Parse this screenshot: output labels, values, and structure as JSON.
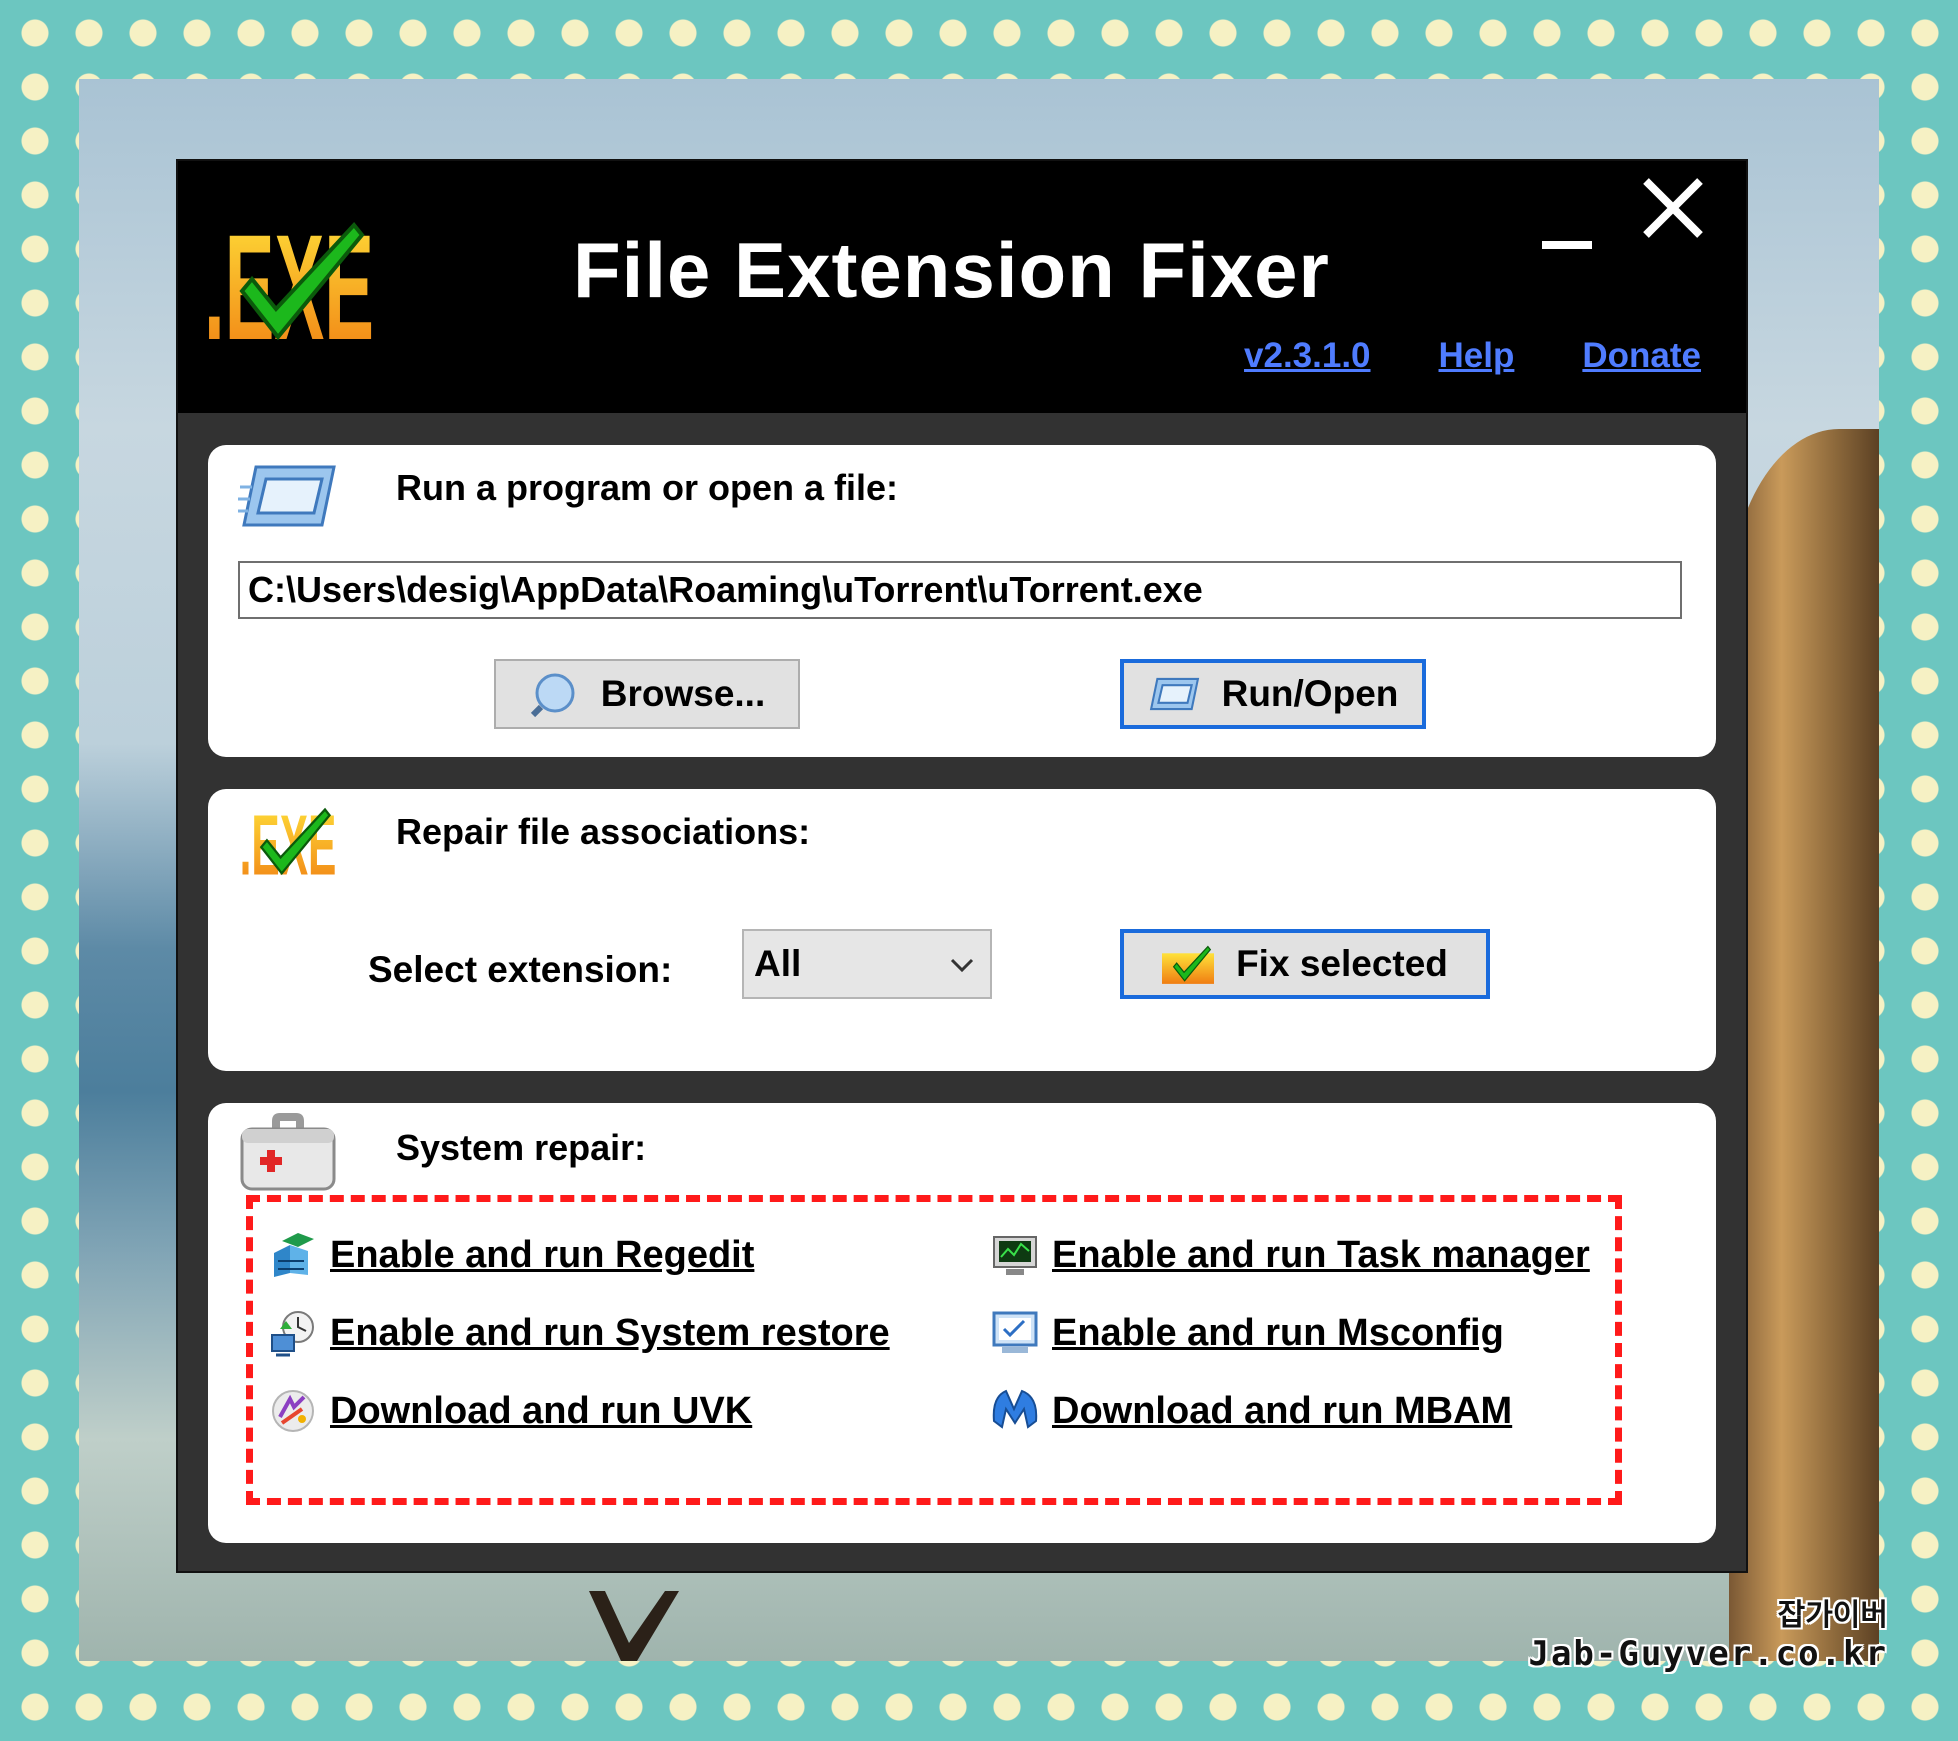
{
  "app": {
    "title": "File Extension Fixer",
    "version_link": "v2.3.1.0",
    "help_link": "Help",
    "donate_link": "Donate"
  },
  "run_section": {
    "title": "Run a program or open a file:",
    "path_value": "C:\\Users\\desig\\AppData\\Roaming\\uTorrent\\uTorrent.exe",
    "browse_label": "Browse...",
    "run_label": "Run/Open"
  },
  "repair_section": {
    "title": "Repair file associations:",
    "select_label": "Select extension:",
    "selected_extension": "All",
    "fix_label": "Fix selected"
  },
  "system_section": {
    "title": "System repair:",
    "links": [
      {
        "label": "Enable and run Regedit",
        "icon": "regedit-icon"
      },
      {
        "label": "Enable and run Task manager",
        "icon": "task-manager-icon"
      },
      {
        "label": "Enable and run System restore",
        "icon": "system-restore-icon"
      },
      {
        "label": "Enable and run Msconfig",
        "icon": "msconfig-icon"
      },
      {
        "label": "Download and run UVK",
        "icon": "uvk-icon"
      },
      {
        "label": "Download and run MBAM",
        "icon": "mbam-icon"
      }
    ]
  },
  "watermark": {
    "line1": "잡가이버",
    "line2": "Jab-Guyver.co.kr"
  },
  "colors": {
    "header_bg": "#000000",
    "link_blue": "#4f7cff",
    "focus_border": "#1a6bdc",
    "highlight_dash": "#ff1a1a"
  }
}
